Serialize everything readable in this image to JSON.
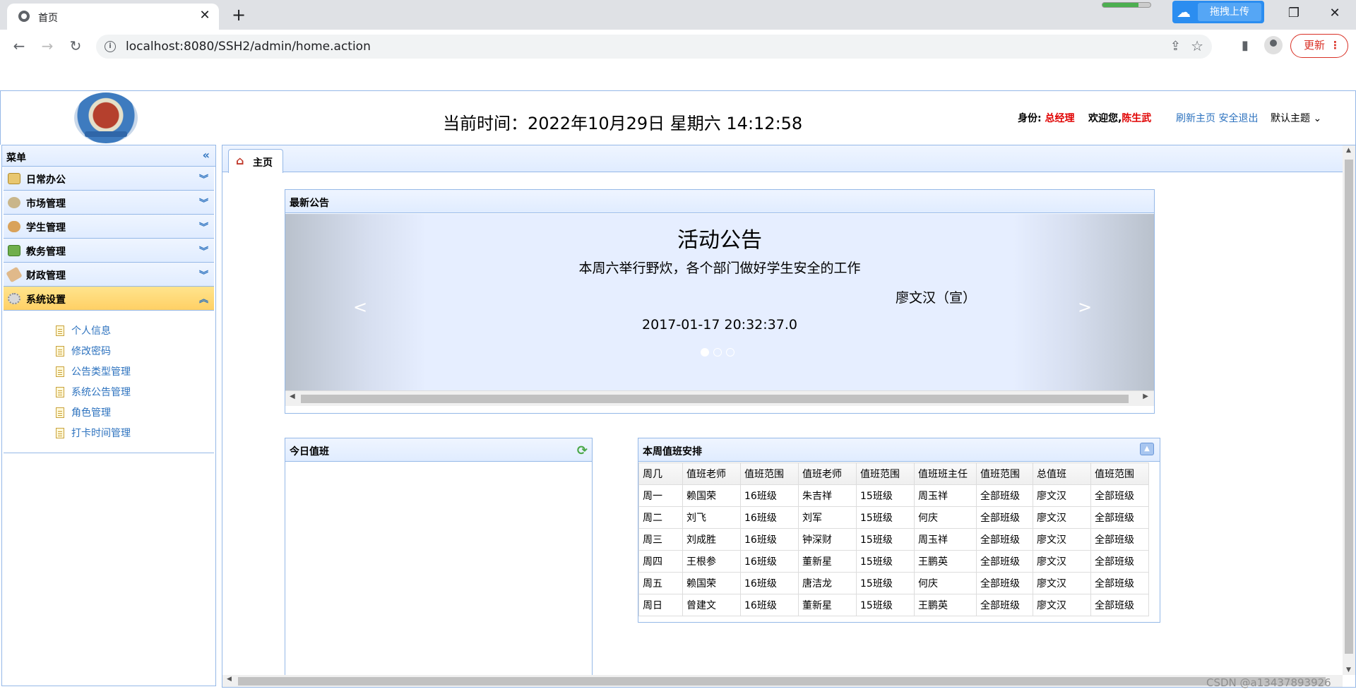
{
  "browser": {
    "tab_title": "首页",
    "url": "localhost:8080/SSH2/admin/home.action",
    "upload_label": "拖拽上传",
    "update_label": "更新"
  },
  "header": {
    "current_time": "当前时间：2022年10月29日 星期六 14:12:58",
    "identity_label": "身份:",
    "identity_value": "总经理",
    "welcome_label": "欢迎您,",
    "welcome_user": "陈生武",
    "refresh_link": "刷新主页",
    "logout_link": "安全退出",
    "theme_label": "默认主题"
  },
  "sidebar": {
    "title": "菜单",
    "groups": [
      {
        "label": "日常办公",
        "icon": "briefcase-icon"
      },
      {
        "label": "市场管理",
        "icon": "money-bag-icon"
      },
      {
        "label": "学生管理",
        "icon": "user-icon"
      },
      {
        "label": "教务管理",
        "icon": "book-icon"
      },
      {
        "label": "财政管理",
        "icon": "bandage-icon"
      },
      {
        "label": "系统设置",
        "icon": "gear-icon"
      }
    ],
    "sub_items": [
      "个人信息",
      "修改密码",
      "公告类型管理",
      "系统公告管理",
      "角色管理",
      "打卡时间管理"
    ]
  },
  "main": {
    "tab_label": "主页",
    "notice": {
      "title": "最新公告",
      "slide_title": "活动公告",
      "slide_content": "本周六举行野炊，各个部门做好学生安全的工作",
      "slide_author": "廖文汉（宣）",
      "slide_date": "2017-01-17 20:32:37.0"
    },
    "duty_today": {
      "title": "今日值班"
    },
    "week_duty": {
      "title": "本周值班安排",
      "columns": [
        "周几",
        "值班老师",
        "值班范围",
        "值班老师",
        "值班范围",
        "值班班主任",
        "值班范围",
        "总值班",
        "值班范围"
      ],
      "rows": [
        [
          "周一",
          "赖国荣",
          "16班级",
          "朱吉祥",
          "15班级",
          "周玉祥",
          "全部班级",
          "廖文汉",
          "全部班级"
        ],
        [
          "周二",
          "刘飞",
          "16班级",
          "刘军",
          "15班级",
          "何庆",
          "全部班级",
          "廖文汉",
          "全部班级"
        ],
        [
          "周三",
          "刘成胜",
          "16班级",
          "钟深财",
          "15班级",
          "周玉祥",
          "全部班级",
          "廖文汉",
          "全部班级"
        ],
        [
          "周四",
          "王根参",
          "16班级",
          "董新星",
          "15班级",
          "王鹏英",
          "全部班级",
          "廖文汉",
          "全部班级"
        ],
        [
          "周五",
          "赖国荣",
          "16班级",
          "唐洁龙",
          "15班级",
          "何庆",
          "全部班级",
          "廖文汉",
          "全部班级"
        ],
        [
          "周日",
          "曾建文",
          "16班级",
          "董新星",
          "15班级",
          "王鹏英",
          "全部班级",
          "廖文汉",
          "全部班级"
        ]
      ]
    }
  },
  "watermark": "CSDN @a13437893926"
}
